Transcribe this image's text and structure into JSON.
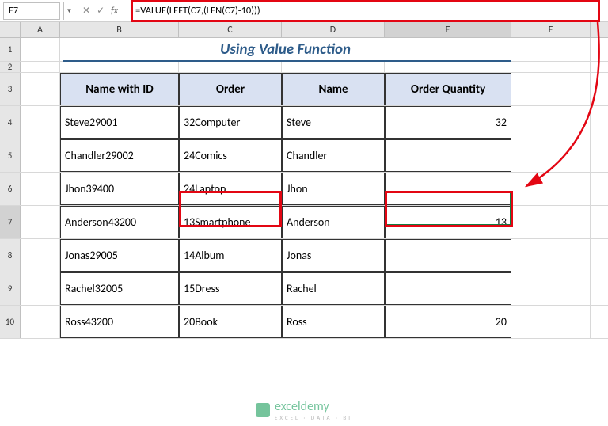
{
  "nameBox": "E7",
  "formula": "=VALUE(LEFT(C7,(LEN(C7)-10)))",
  "columns": {
    "A": "A",
    "B": "B",
    "C": "C",
    "D": "D",
    "E": "E",
    "F": "F"
  },
  "rowLabels": [
    "1",
    "2",
    "3",
    "4",
    "5",
    "6",
    "7",
    "8",
    "9",
    "10"
  ],
  "title": "Using Value Function",
  "headers": {
    "b": "Name with ID",
    "c": "Order",
    "d": "Name",
    "e": "Order Quantity"
  },
  "rows": [
    {
      "b": "Steve29001",
      "c": "32Computer",
      "d": "Steve",
      "e": "32"
    },
    {
      "b": "Chandler29002",
      "c": "24Comics",
      "d": "Chandler",
      "e": ""
    },
    {
      "b": "Jhon39400",
      "c": "24Laptop",
      "d": "Jhon",
      "e": ""
    },
    {
      "b": "Anderson43200",
      "c": "13Smartphone",
      "d": "Anderson",
      "e": "13"
    },
    {
      "b": "Jonas29005",
      "c": "14Album",
      "d": "Jonas",
      "e": ""
    },
    {
      "b": "Rachel32005",
      "c": "15Dress",
      "d": "Rachel",
      "e": ""
    },
    {
      "b": "Ross43200",
      "c": "20Book",
      "d": "Ross",
      "e": "20"
    }
  ],
  "watermark": {
    "brand": "exceldemy",
    "sub": "EXCEL · DATA · BI"
  }
}
